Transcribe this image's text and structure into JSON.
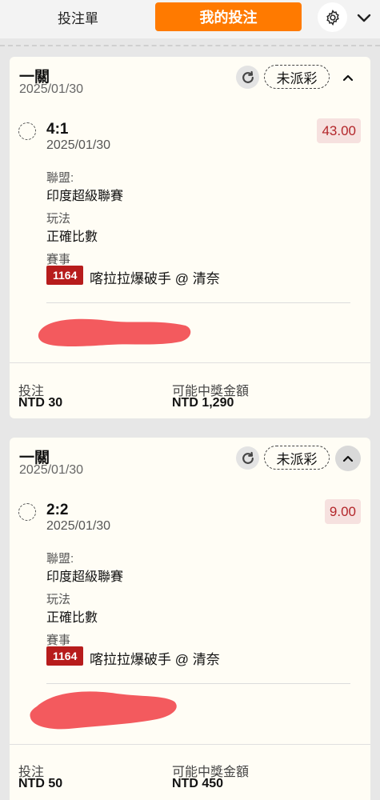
{
  "header": {
    "tab_betslip": "投注單",
    "tab_mybets": "我的投注",
    "gear_icon": "gear-icon",
    "chevron_icon": "chevron-down-icon"
  },
  "colors": {
    "accent": "#ff7a00",
    "odds_text": "#b3262a",
    "odds_bg": "#f6e1df",
    "event_badge": "#b71c1c",
    "card_bg": "#fffdf5"
  },
  "bets": [
    {
      "type": "一關",
      "date": "2025/01/30",
      "status": "未派彩",
      "selection": "4:1",
      "selection_date": "2025/01/30",
      "odds": "43.00",
      "league_label": "聯盟:",
      "league": "印度超級聯賽",
      "market_label": "玩法",
      "market": "正確比數",
      "event_label": "賽事",
      "event_id": "1164",
      "event_name": "喀拉拉爆破手 @ 清奈",
      "stake_label": "投注",
      "stake": "NTD 30",
      "payout_label": "可能中獎金額",
      "payout": "NTD 1,290"
    },
    {
      "type": "一關",
      "date": "2025/01/30",
      "status": "未派彩",
      "selection": "2:2",
      "selection_date": "2025/01/30",
      "odds": "9.00",
      "league_label": "聯盟:",
      "league": "印度超級聯賽",
      "market_label": "玩法",
      "market": "正確比數",
      "event_label": "賽事",
      "event_id": "1164",
      "event_name": "喀拉拉爆破手 @ 清奈",
      "stake_label": "投注",
      "stake": "NTD 50",
      "payout_label": "可能中獎金額",
      "payout": "NTD 450"
    }
  ]
}
